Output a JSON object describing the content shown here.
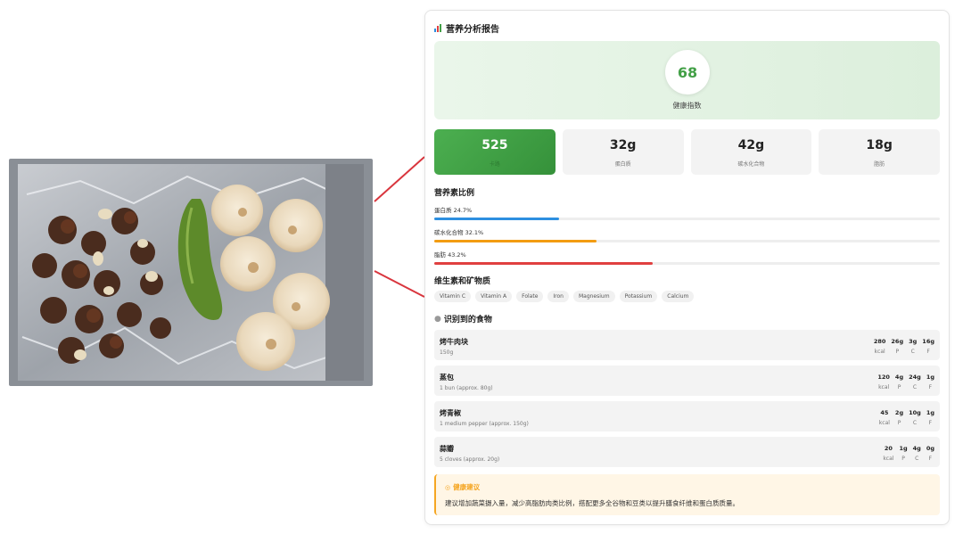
{
  "report": {
    "title": "营养分析报告",
    "health_score": "68",
    "health_label": "健康指数",
    "stats": [
      {
        "value": "525",
        "label": "卡路"
      },
      {
        "value": "32g",
        "label": "蛋白质"
      },
      {
        "value": "42g",
        "label": "碳水化合物"
      },
      {
        "value": "18g",
        "label": "脂肪"
      }
    ],
    "ratio_title": "营养素比例",
    "ratios": [
      {
        "label": "蛋白质 24.7%",
        "percent": 24.7,
        "color": "#2d8fe0"
      },
      {
        "label": "碳水化合物 32.1%",
        "percent": 32.1,
        "color": "#f39c12"
      },
      {
        "label": "脂肪 43.2%",
        "percent": 43.2,
        "color": "#e04040"
      }
    ],
    "vitamins_title": "维生素和矿物质",
    "vitamins": [
      "Vitamin C",
      "Vitamin A",
      "Folate",
      "Iron",
      "Magnesium",
      "Potassium",
      "Calcium"
    ],
    "foods_title": "识别到的食物",
    "macro_units": [
      "kcal",
      "P",
      "C",
      "F"
    ],
    "foods": [
      {
        "name": "烤牛肉块",
        "portion": "150g",
        "kcal": "280",
        "p": "26g",
        "c": "3g",
        "f": "16g"
      },
      {
        "name": "蒸包",
        "portion": "1 bun (approx. 80g)",
        "kcal": "120",
        "p": "4g",
        "c": "24g",
        "f": "1g"
      },
      {
        "name": "烤青椒",
        "portion": "1 medium pepper (approx. 150g)",
        "kcal": "45",
        "p": "2g",
        "c": "10g",
        "f": "1g"
      },
      {
        "name": "蒜瓣",
        "portion": "5 cloves (approx. 20g)",
        "kcal": "20",
        "p": "1g",
        "c": "4g",
        "f": "0g"
      }
    ],
    "advice_title": "健康建议",
    "advice_text": "建议增加蔬菜摄入量，减少高脂肪肉类比例，搭配更多全谷物和豆类以提升膳食纤维和蛋白质质量。"
  },
  "colors": {
    "accent_green": "#43a047",
    "connector": "#d9363e",
    "advice": "#f5a623"
  }
}
